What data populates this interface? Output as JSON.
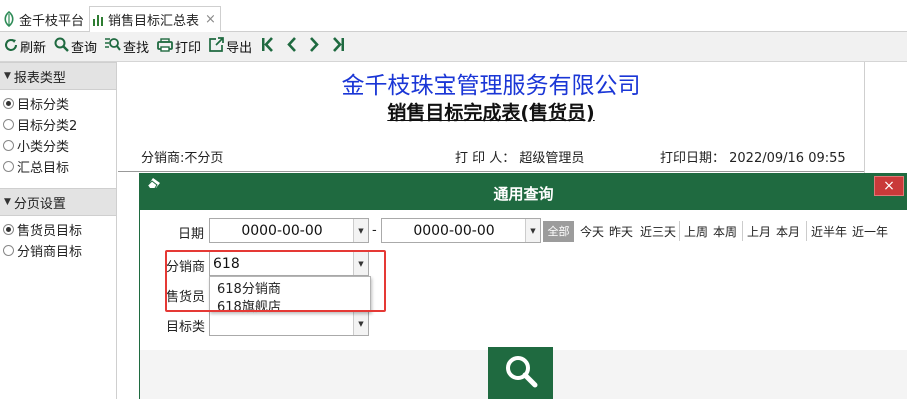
{
  "tabs": {
    "home": "金千枝平台",
    "active": "销售目标汇总表",
    "close": "×"
  },
  "toolbar": {
    "refresh": "刷新",
    "query": "查询",
    "find": "查找",
    "print": "打印",
    "export": "导出"
  },
  "sidebar": {
    "section1": "报表类型",
    "items1": [
      "目标分类",
      "目标分类2",
      "小类分类",
      "汇总目标"
    ],
    "section2": "分页设置",
    "items2": [
      "售货员目标",
      "分销商目标"
    ]
  },
  "report": {
    "company": "金千枝珠宝管理服务有限公司",
    "title": "销售目标完成表(售货员)",
    "distributor": "分销商:不分页",
    "printer": "打 印 人：  超级管理员",
    "print_date": "打印日期：  2022/09/16 09:55"
  },
  "dialog": {
    "title": "通用查询",
    "close": "×",
    "date_label": "日期",
    "date_from": "0000-00-00",
    "dash": "-",
    "date_to": "0000-00-00",
    "all": "全部",
    "quick": [
      "今天",
      "昨天",
      "近三天",
      "上周",
      "本周",
      "上月",
      "本月",
      "近半年",
      "近一年"
    ],
    "distributor_label": "分销商",
    "distributor_value": "618",
    "salesperson_label": "售货员",
    "target_label": "目标类",
    "dropdown": [
      "618分销商",
      "618旗舰店"
    ]
  },
  "colors": {
    "green": "#1f6a40",
    "blue_title": "#1a36d6",
    "highlight": "#e53935",
    "close_red": "#c93a3a"
  },
  "icons": [
    "refresh-icon",
    "search-icon",
    "find-icon",
    "print-icon",
    "export-icon",
    "first-page-icon",
    "prev-page-icon",
    "next-page-icon",
    "last-page-icon",
    "eraser-icon",
    "leaf-icon",
    "chart-icon"
  ]
}
